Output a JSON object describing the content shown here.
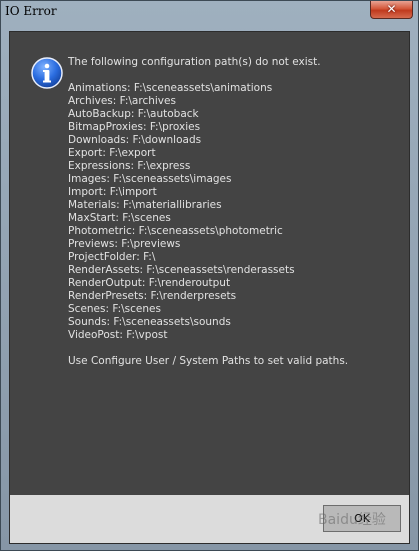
{
  "window": {
    "title": "IO Error"
  },
  "dialog": {
    "intro": "The following configuration path(s) do not exist.",
    "paths": [
      "Animations: F:\\sceneassets\\animations",
      "Archives: F:\\archives",
      "AutoBackup: F:\\autoback",
      "BitmapProxies: F:\\proxies",
      "Downloads: F:\\downloads",
      "Export: F:\\export",
      "Expressions: F:\\express",
      "Images: F:\\sceneassets\\images",
      "Import: F:\\import",
      "Materials: F:\\materiallibraries",
      "MaxStart: F:\\scenes",
      "Photometric: F:\\sceneassets\\photometric",
      "Previews: F:\\previews",
      "ProjectFolder: F:\\",
      "RenderAssets: F:\\sceneassets\\renderassets",
      "RenderOutput: F:\\renderoutput",
      "RenderPresets: F:\\renderpresets",
      "Scenes: F:\\scenes",
      "Sounds: F:\\sceneassets\\sounds",
      "VideoPost: F:\\vpost"
    ],
    "hint": "Use Configure User / System Paths to set valid paths."
  },
  "footer": {
    "ok_label": "OK",
    "watermark_text": "Baidu经验"
  },
  "icons": {
    "close": "close-icon",
    "info": "info-icon"
  },
  "colors": {
    "content_bg": "#444444",
    "text": "#e2e2e2",
    "info_blue": "#1f5fd1",
    "close_red": "#c8452a"
  }
}
